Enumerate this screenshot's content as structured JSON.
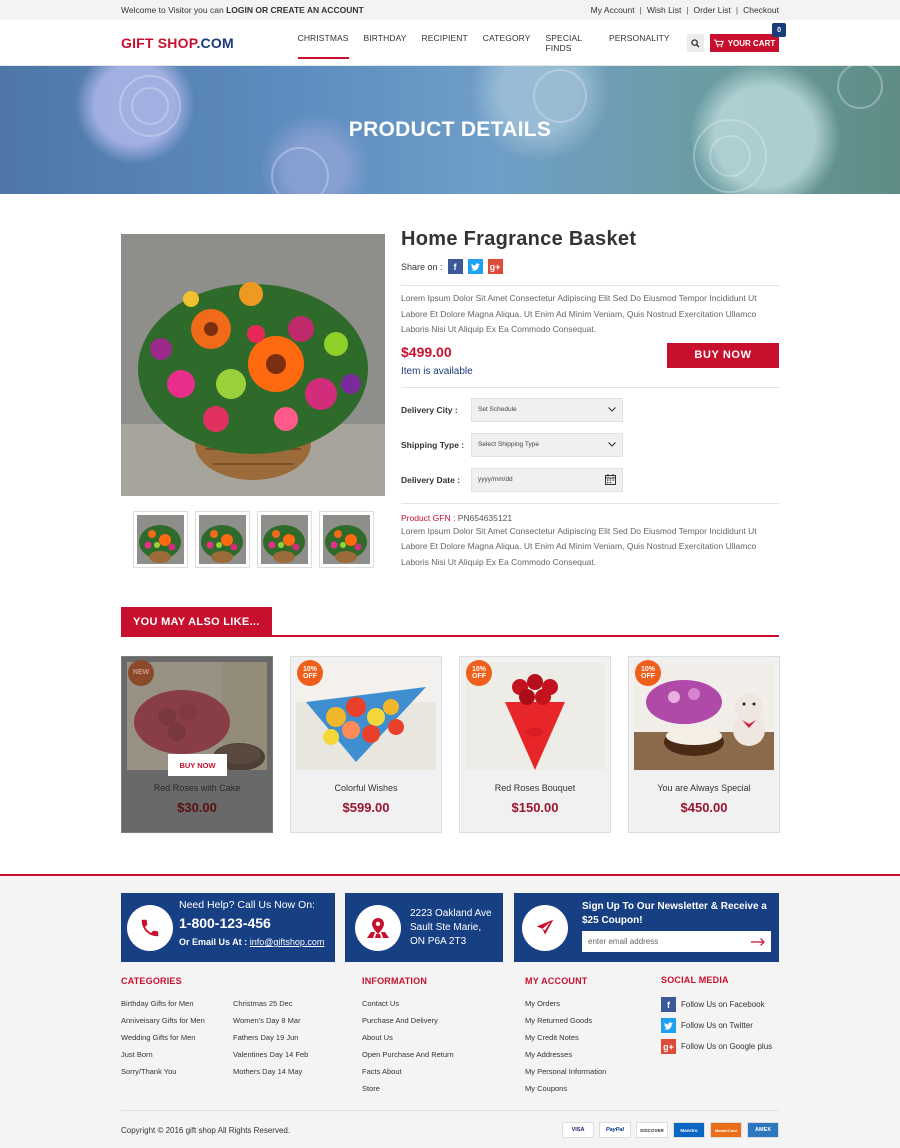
{
  "topbar": {
    "welcome": "Welcome to Visitor you can",
    "login": "LOGIN",
    "or": "OR",
    "create": "CREATE AN ACCOUNT",
    "links": [
      "My Account",
      "Wish List",
      "Order List",
      "Checkout"
    ]
  },
  "header": {
    "logo_main": "GIFT SHOP",
    "logo_suffix": ".COM",
    "nav": [
      "CHRISTMAS",
      "BIRTHDAY",
      "RECIPIENT",
      "CATEGORY",
      "SPECIAL FINDS",
      "PERSONALITY"
    ],
    "cart_label": "YOUR CART",
    "cart_count": "0"
  },
  "banner": {
    "title": "PRODUCT DETAILS"
  },
  "product": {
    "title": "Home Fragrance Basket",
    "share_label": "Share on :",
    "description": "Lorem Ipsum Dolor Sit Amet Consectetur Adipiscing Elit Sed Do Eiusmod Tempor Incididunt Ut Labore Et Dolore Magna Aliqua. Ut Enim Ad Minim Veniam, Quis Nostrud Exercitation Ullamco Laboris Nisi Ut Aliquip Ex Ea Commodo Consequat.",
    "price": "$499.00",
    "availability": "Item is available",
    "buy_label": "BUY NOW",
    "fields": [
      {
        "label": "Delivery City :",
        "value": "Set Schedule"
      },
      {
        "label": "Shipping Type :",
        "value": "Select Shipping Type"
      },
      {
        "label": "Delivery Date :",
        "value": "yyyy/mm/dd"
      }
    ],
    "gfn_label": "Product GFN :",
    "gfn_value": "PN654635121",
    "description2": "Lorem Ipsum Dolor Sit Amet Consectetur Adipiscing Elit Sed Do Eiusmod Tempor Incididunt Ut Labore Et Dolore Magna Aliqua. Ut Enim Ad Minim Veniam, Quis Nostrud Exercitation Ullamco Laboris Nisi Ut Aliquip Ex Ea Commodo Consequat."
  },
  "also_like": {
    "heading": "YOU MAY ALSO LIKE...",
    "items": [
      {
        "badge": "NEW",
        "name": "Red Roses with Cake",
        "price": "$30.00",
        "button": "BUY NOW"
      },
      {
        "badge": "10% OFF",
        "name": "Colorful Wishes",
        "price": "$599.00"
      },
      {
        "badge": "10% OFF",
        "name": "Red Roses Bouquet",
        "price": "$150.00"
      },
      {
        "badge": "10% OFF",
        "name": "You are Always Special",
        "price": "$450.00"
      }
    ]
  },
  "footer": {
    "help_title": "Need Help? Call Us Now On:",
    "phone": "1-800-123-456",
    "email_label": "Or Email Us At :",
    "email": "info@giftshop.com",
    "address_lines": [
      "2223 Oakland Ave",
      "Sault Ste Marie,",
      "ON P6A 2T3"
    ],
    "newsletter_title": "Sign Up To Our Newsletter & Receive a $25 Coupon!",
    "newsletter_placeholder": "enter email address",
    "categories": {
      "heading": "CATEGORIES",
      "col1": [
        "Birthday Gifts for Men",
        "Anniveisary Gifts for Men",
        "Wedding Gifts for Men",
        "Just Born",
        "Sorry/Thank You"
      ],
      "col2": [
        "Christmas 25 Dec",
        "Women's Day 8 Mar",
        "Fathers Day 19 Jun",
        "Valentines Day 14 Feb",
        "Mothers Day 14 May"
      ]
    },
    "information": {
      "heading": "INFORMATION",
      "items": [
        "Contact Us",
        "Purchase And Delivery",
        "About Us",
        "Open Purchase And Return",
        "Facts About",
        "Store"
      ]
    },
    "account": {
      "heading": "MY ACCOUNT",
      "items": [
        "My Orders",
        "My Returned Goods",
        "My Credit Notes",
        "My Addresses",
        "My Personal Information",
        "My Coupons"
      ]
    },
    "social": {
      "heading": "SOCIAL MEDIA",
      "items": [
        "Follow Us on Facebook",
        "Follow Us on Twitter",
        "Follow Us on Google plus"
      ]
    },
    "copyright": "Copyright © 2016 gift shop All Rights Reserved.",
    "payments": [
      "VISA",
      "PayPal",
      "DISCOVER",
      "Maestro",
      "MasterCard",
      "AMEX"
    ]
  },
  "colors": {
    "brand_red": "#c8102e",
    "brand_blue": "#163f84",
    "badge_orange": "#ee5f1c"
  }
}
